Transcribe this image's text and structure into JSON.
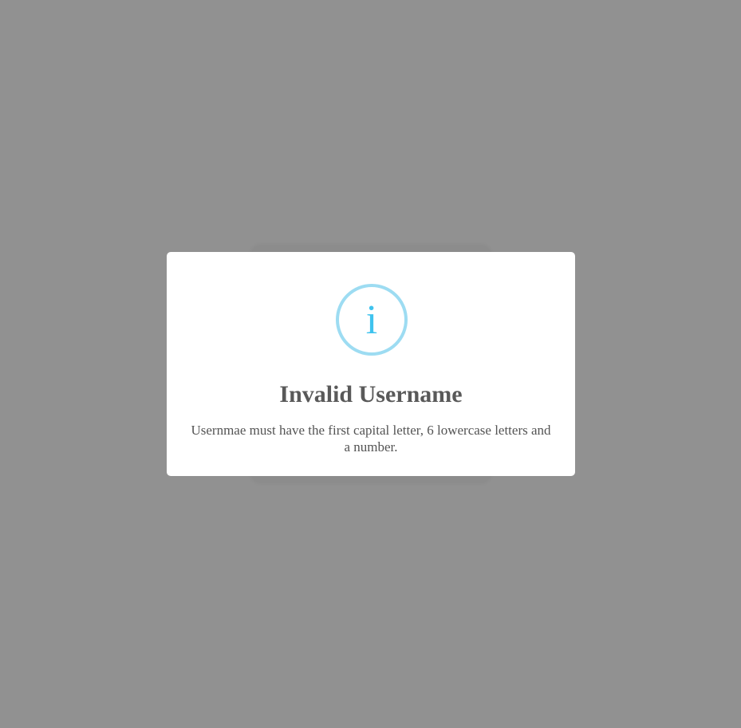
{
  "dialog": {
    "icon": "info-icon",
    "icon_glyph": "i",
    "title": "Invalid Username",
    "message": "Usernmae must have the first capital letter, 6 lowercase letters and a number."
  },
  "colors": {
    "overlay": "#919191",
    "modal_background": "#ffffff",
    "icon_border": "#9ddcf2",
    "icon_glyph": "#3fc3ee",
    "title_text": "#595959",
    "message_text": "#545454"
  }
}
